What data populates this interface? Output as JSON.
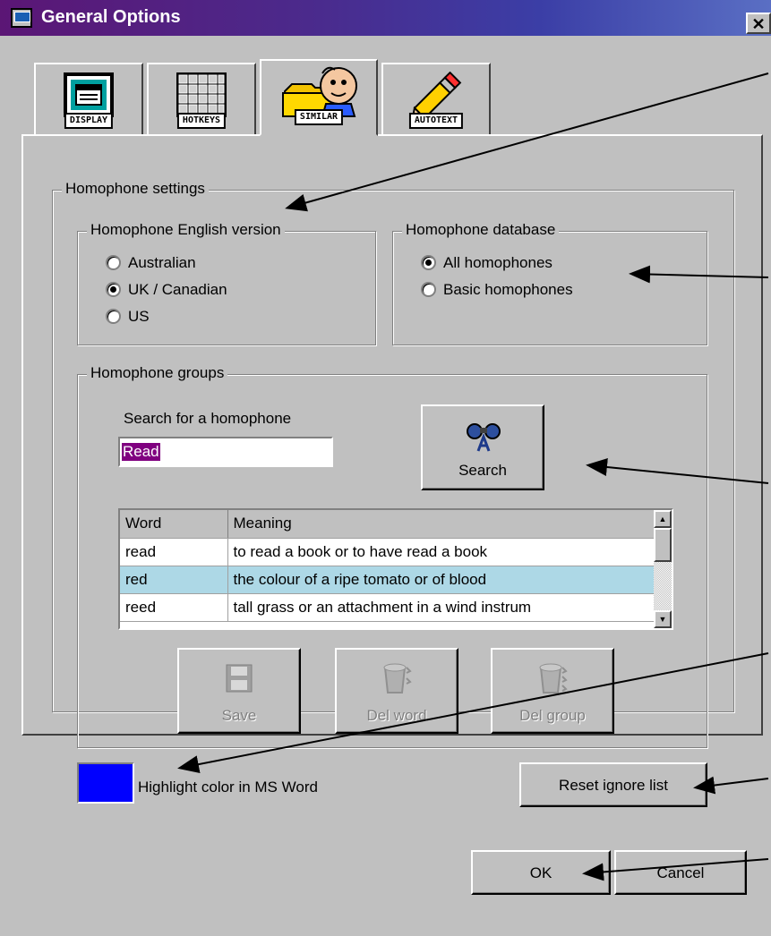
{
  "window": {
    "title": "General Options",
    "close_label": "✕"
  },
  "tabs": [
    {
      "label": "DISPLAY",
      "icon": "display-icon"
    },
    {
      "label": "HOTKEYS",
      "icon": "hotkeys-icon"
    },
    {
      "label": "SIMILAR",
      "icon": "similar-icon",
      "active": true
    },
    {
      "label": "AUTOTEXT",
      "icon": "pencil-icon"
    }
  ],
  "homophone_settings": {
    "title": "Homophone settings",
    "english_version": {
      "title": "Homophone English version",
      "options": [
        {
          "label": "Australian",
          "checked": false
        },
        {
          "label": "UK / Canadian",
          "checked": true
        },
        {
          "label": "US",
          "checked": false
        }
      ]
    },
    "database": {
      "title": "Homophone database",
      "options": [
        {
          "label": "All homophones",
          "checked": true
        },
        {
          "label": "Basic homophones",
          "checked": false
        }
      ]
    },
    "groups": {
      "title": "Homophone groups",
      "search_label": "Search for a homophone",
      "search_value": "Read",
      "search_button": "Search",
      "table": {
        "columns": [
          "Word",
          "Meaning"
        ],
        "rows": [
          {
            "word": "read",
            "meaning": "to read a book or to have read a book"
          },
          {
            "word": "red",
            "meaning": "the colour of a ripe tomato or of blood",
            "selected": true
          },
          {
            "word": "reed",
            "meaning": "tall grass or an attachment in a wind instrum"
          }
        ]
      },
      "buttons": {
        "save": "Save",
        "del_word": "Del word",
        "del_group": "Del group"
      }
    },
    "highlight_label": "Highlight color in MS Word",
    "highlight_color": "#0000ff",
    "reset_button": "Reset ignore list"
  },
  "footer": {
    "ok": "OK",
    "cancel": "Cancel"
  }
}
